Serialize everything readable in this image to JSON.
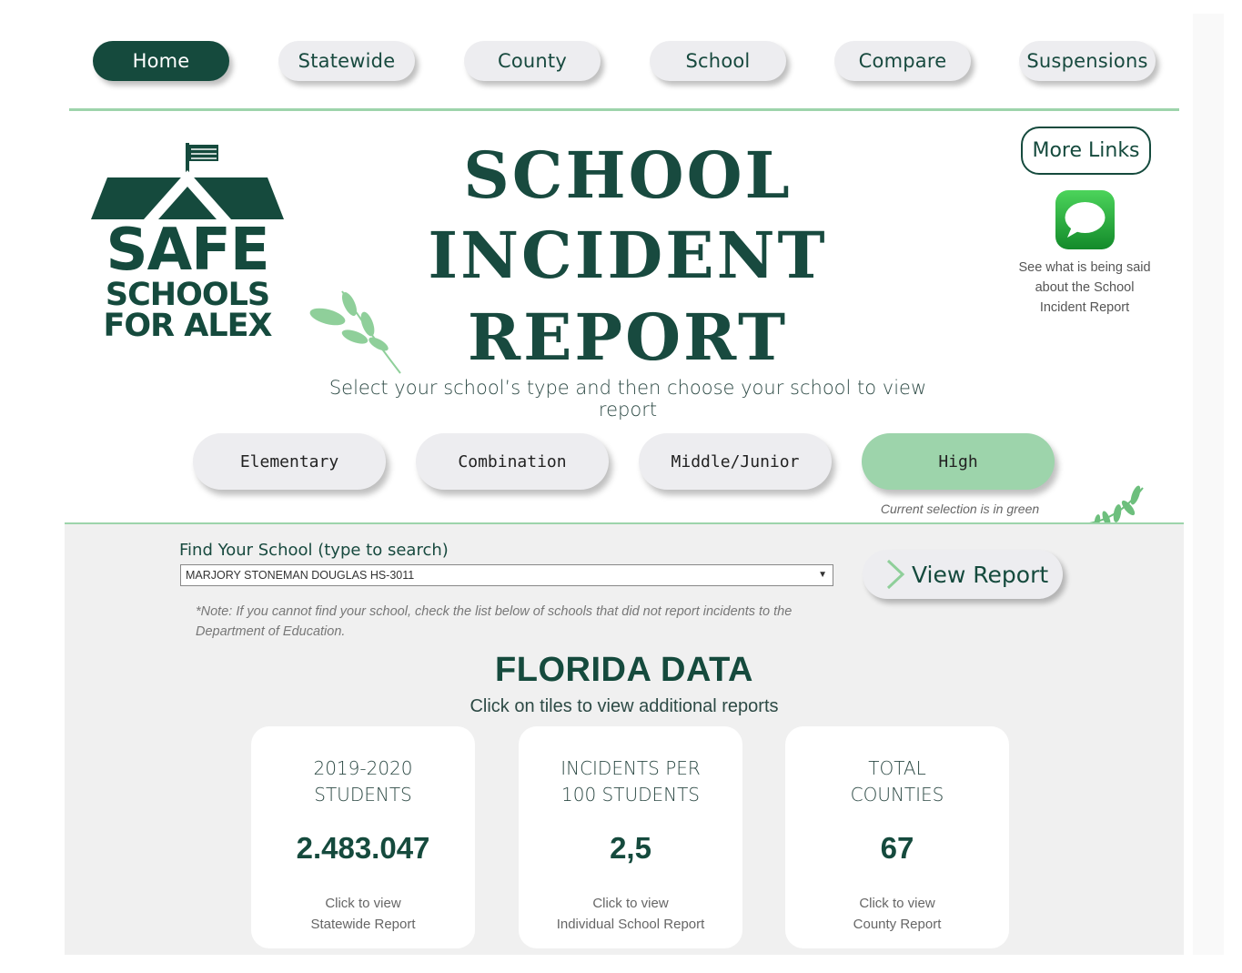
{
  "nav": {
    "items": [
      {
        "label": "Home",
        "active": true
      },
      {
        "label": "Statewide",
        "active": false
      },
      {
        "label": "County",
        "active": false
      },
      {
        "label": "School",
        "active": false
      },
      {
        "label": "Compare",
        "active": false
      },
      {
        "label": "Suspensions",
        "active": false
      }
    ]
  },
  "logo": {
    "line1": "SAFE",
    "line2": "SCHOOLS",
    "line3": "FOR ALEX"
  },
  "header": {
    "title_line1": "SCHOOL",
    "title_line2": "INCIDENT",
    "title_line3": "REPORT",
    "subtitle": "Select your school’s type and then choose your school to view report"
  },
  "more_links": {
    "label": "More Links",
    "caption": "See what is being said about the School Incident Report",
    "icon": "message-bubble-icon"
  },
  "school_types": {
    "items": [
      {
        "label": "Elementary",
        "selected": false
      },
      {
        "label": "Combination",
        "selected": false
      },
      {
        "label": "Middle/Junior",
        "selected": false
      },
      {
        "label": "High",
        "selected": true
      }
    ],
    "note": "Current selection is in green"
  },
  "search": {
    "label": "Find Your School (type to search)",
    "value": "MARJORY STONEMAN DOUGLAS HS-3011",
    "button": "View Report",
    "note": "*Note: If you cannot find your school, check the list below of schools that did not report incidents to the Department of Education."
  },
  "florida": {
    "title": "FLORIDA DATA",
    "subtitle": "Click on tiles to view additional reports",
    "tiles": [
      {
        "label1": "2019-2020",
        "label2": "STUDENTS",
        "value": "2.483.047",
        "link1": "Click to view",
        "link2": "Statewide Report"
      },
      {
        "label1": "INCIDENTS PER",
        "label2": "100 STUDENTS",
        "value": "2,5",
        "link1": "Click to view",
        "link2": "Individual School Report"
      },
      {
        "label1": "TOTAL",
        "label2": "COUNTIES",
        "value": "67",
        "link1": "Click to view",
        "link2": "County Report"
      }
    ]
  },
  "colors": {
    "primary": "#154a3d",
    "accent": "#9dd4ab",
    "panel": "#f0f0f0"
  }
}
